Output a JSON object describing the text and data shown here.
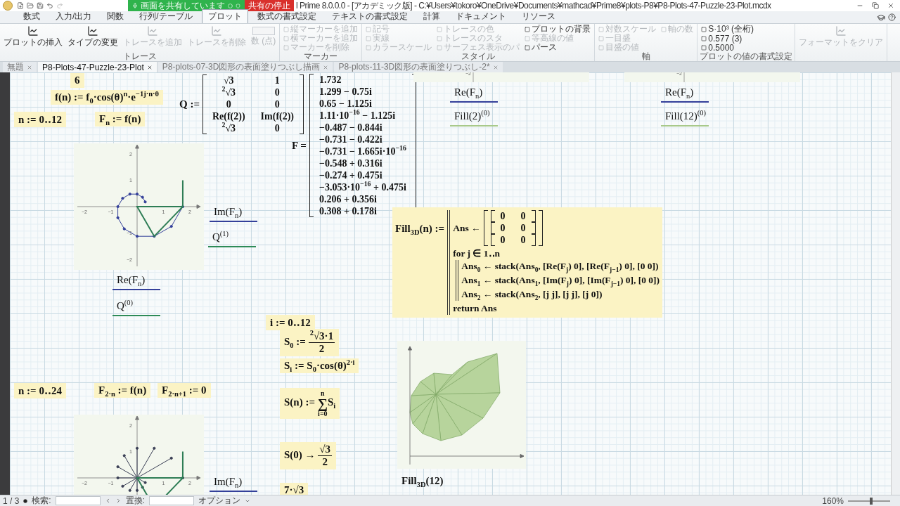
{
  "title_bar": {
    "share_status": "画面を共有しています",
    "stop_share": "共有の停止",
    "title": "l Prime 8.0.0.0 - [アカデミック版] - C:¥Users¥tokoro¥OneDrive¥Documents¥mathcad¥Prime8¥plots-P8¥P8-Plots-47-Puzzle-23-Plot.mcdx"
  },
  "ribbon_tabs": [
    {
      "label": "数式",
      "selected": false
    },
    {
      "label": "入力/出力",
      "selected": false
    },
    {
      "label": "関数",
      "selected": false
    },
    {
      "label": "行列/テーブル",
      "selected": false
    },
    {
      "label": "プロット",
      "selected": true
    },
    {
      "label": "数式の書式設定",
      "selected": false
    },
    {
      "label": "テキストの書式設定",
      "selected": false
    },
    {
      "label": "計算",
      "selected": false
    },
    {
      "label": "ドキュメント",
      "selected": false
    },
    {
      "label": "リソース",
      "selected": false
    }
  ],
  "ribbon_groups": [
    {
      "label": "トレース",
      "items": [
        {
          "kind": "large",
          "label": "プロットの挿入",
          "disabled": false
        },
        {
          "kind": "large",
          "label": "タイプの変更",
          "disabled": false
        },
        {
          "kind": "large",
          "label": "トレースを追加",
          "disabled": true
        },
        {
          "kind": "large",
          "label": "トレースを削除",
          "disabled": true
        },
        {
          "kind": "value",
          "label": "数 (点)",
          "disabled": true
        }
      ]
    },
    {
      "label": "マーカー",
      "items": [
        {
          "kind": "small",
          "label": "縦マーカーを追加",
          "disabled": true
        },
        {
          "kind": "small",
          "label": "横マーカーを追加",
          "disabled": true
        },
        {
          "kind": "small",
          "label": "マーカーを削除",
          "disabled": true
        }
      ]
    },
    {
      "label": "スタイル",
      "items": [
        {
          "kind": "small",
          "label": "記号",
          "disabled": true
        },
        {
          "kind": "small",
          "label": "実線",
          "disabled": true
        },
        {
          "kind": "small",
          "label": "カラースケール",
          "disabled": true
        },
        {
          "kind": "small",
          "label": "トレースの色",
          "disabled": true
        },
        {
          "kind": "small",
          "label": "トレースのスタ",
          "disabled": true
        },
        {
          "kind": "small",
          "label": "サーフェス表示のパ",
          "disabled": true
        },
        {
          "kind": "small",
          "label": "プロットの背景",
          "disabled": false
        },
        {
          "kind": "small",
          "label": "等高線の値",
          "disabled": true
        },
        {
          "kind": "small",
          "label": "パース",
          "disabled": false
        }
      ]
    },
    {
      "label": "軸",
      "items": [
        {
          "kind": "small",
          "label": "対数スケール",
          "disabled": true
        },
        {
          "kind": "small",
          "label": "一目盛",
          "disabled": true
        },
        {
          "kind": "small",
          "label": "目盛の値",
          "disabled": true
        },
        {
          "kind": "small",
          "label": "軸の数",
          "disabled": true
        }
      ]
    },
    {
      "label": "プロットの値の書式設定",
      "items": [
        {
          "kind": "small",
          "label": "S·10³ (全桁)",
          "disabled": false
        },
        {
          "kind": "small",
          "label": "0.577 (3)",
          "disabled": false
        },
        {
          "kind": "small",
          "label": "0.5000",
          "disabled": false
        }
      ]
    },
    {
      "items": [
        {
          "kind": "large",
          "label": "フォーマットをクリア",
          "disabled": true
        }
      ]
    }
  ],
  "doc_tabs": [
    {
      "label": "無題",
      "selected": false
    },
    {
      "label": "P8-Plots-47-Puzzle-23-Plot",
      "selected": true
    },
    {
      "label": "P8-plots-07-3D図形の表面塗りつぶし描画",
      "selected": false
    },
    {
      "label": "P8-plots-11-3D図形の表面塗りつぶし-2*",
      "selected": false
    }
  ],
  "worksheet": [
    {
      "kind": "math",
      "text": "6"
    },
    {
      "kind": "math",
      "text": "f(n) := f$_{0}$·cos(θ)$^{n}$·e$^{−1j·n·θ}$"
    },
    {
      "kind": "math",
      "text": "n := 0‥12"
    },
    {
      "kind": "math",
      "text": "F$_{n}$ := f(n)"
    },
    {
      "kind": "matrix",
      "lhs": "Q :=",
      "rows": [
        [
          "√3",
          "1"
        ],
        [
          "$^{2}$√3",
          "0"
        ],
        [
          "0",
          "0"
        ],
        [
          "Re(f(2))",
          "Im(f(2))"
        ],
        [
          "$^{2}$√3",
          "0"
        ]
      ]
    },
    {
      "kind": "matrix",
      "lhs": "F =",
      "rows": [
        [
          "1.732"
        ],
        [
          "1.299 − 0.75i"
        ],
        [
          "0.65 − 1.125i"
        ],
        [
          "1.11·10$^{−16}$ − 1.125i"
        ],
        [
          "−0.487 − 0.844i"
        ],
        [
          "−0.731 − 0.422i"
        ],
        [
          "−0.731 − 1.665i·10$^{−16}$"
        ],
        [
          "−0.548 + 0.316i"
        ],
        [
          "−0.274 + 0.475i"
        ],
        [
          "−3.053·10$^{−16}$ + 0.475i"
        ],
        [
          "0.206 + 0.356i"
        ],
        [
          "0.308 + 0.178i"
        ]
      ]
    },
    {
      "kind": "plot",
      "x_ticks": [
        "−2",
        "−1",
        "1",
        "2"
      ],
      "y_ticks": [
        "2",
        "1",
        "−1",
        "−2"
      ]
    },
    {
      "kind": "trace",
      "text": "Im(F$_{n}$)",
      "color": "#34409a"
    },
    {
      "kind": "trace",
      "text": "Q$^{(1)}$",
      "color": "#2e8b57"
    },
    {
      "kind": "trace",
      "text": "Re(F$_{n}$)",
      "color": "#34409a"
    },
    {
      "kind": "trace",
      "text": "Q$^{(0)}$",
      "color": "#2e8b57"
    },
    {
      "kind": "plotedge",
      "y_ticks": [
        "−2"
      ]
    },
    {
      "kind": "trace",
      "text": "Re(F$_{n}$)",
      "color": "#34409a"
    },
    {
      "kind": "trace",
      "text": "Fill(2)$^{(0)}$",
      "color": "#a8c98a"
    },
    {
      "kind": "plotedge",
      "y_ticks": [
        "−2"
      ]
    },
    {
      "kind": "trace",
      "text": "Re(F$_{n}$)",
      "color": "#34409a"
    },
    {
      "kind": "trace",
      "text": "Fill(12)$^{(0)}$",
      "color": "#a8c98a"
    },
    {
      "kind": "program",
      "name": "Fill$_{3D}$(n) :=",
      "lines": [
        {
          "kind": "matrix_assign",
          "text": "Ans ←",
          "rows": [
            [
              "0",
              "0"
            ],
            [
              "0",
              "0"
            ],
            [
              "0",
              "0"
            ]
          ]
        },
        {
          "kind": "loop",
          "text": "for j ∈ 1‥n",
          "children": [
            {
              "kind": "line",
              "text": "Ans$_{0}$ ← stack(Ans$_{0}$, [Re(F$_{j}$)  0], [Re(F$_{j−1}$)  0], [0  0])"
            },
            {
              "kind": "line",
              "text": "Ans$_{1}$ ← stack(Ans$_{1}$, [Im(F$_{j}$)  0], [Im(F$_{j−1}$)  0], [0  0])"
            },
            {
              "kind": "line",
              "text": "Ans$_{2}$ ← stack(Ans$_{2}$, [j  j], [j  j], [j  0])"
            }
          ]
        },
        {
          "kind": "line",
          "text": "return Ans"
        }
      ]
    },
    {
      "kind": "math",
      "text": "i := 0‥12"
    },
    {
      "kind": "fraction",
      "lhs": "S$_{0}$ :=",
      "numerator": "$^{2}$√3·1",
      "denominator": "2"
    },
    {
      "kind": "math",
      "text": "S$_{i}$ := S$_{0}$·cos(θ)$^{2·i}$"
    },
    {
      "kind": "sum",
      "lhs": "S(n) :=",
      "upper": "n",
      "symbol": "∑",
      "lower": "i=0",
      "body": "S$_{i}$"
    },
    {
      "kind": "math",
      "text": "n := 0‥24"
    },
    {
      "kind": "math",
      "text": "F$_{2·n}$ := f(n)"
    },
    {
      "kind": "math",
      "text": "F$_{2·n+1}$ := 0"
    },
    {
      "kind": "starplot",
      "x_ticks": [
        "−2",
        "−1",
        "1",
        "2"
      ],
      "y_ticks": [
        "2",
        "1"
      ]
    },
    {
      "kind": "trace",
      "text": "Im(F$_{n}$)",
      "color": "#34409a"
    },
    {
      "kind": "surfaceplot"
    },
    {
      "kind": "label",
      "text": "Fill$_{3D}$(12)"
    },
    {
      "kind": "fraction",
      "lhs": "S(0) →",
      "numerator": "√3",
      "denominator": "2"
    },
    {
      "kind": "math",
      "text": "7·√3"
    }
  ],
  "status_bar": {
    "page": "1 / 3",
    "find_label": "検索:",
    "replace_label": "置換:",
    "options": "オプション",
    "zoom": "160%",
    "zoom_slider": {
      "level": 0.55
    }
  }
}
